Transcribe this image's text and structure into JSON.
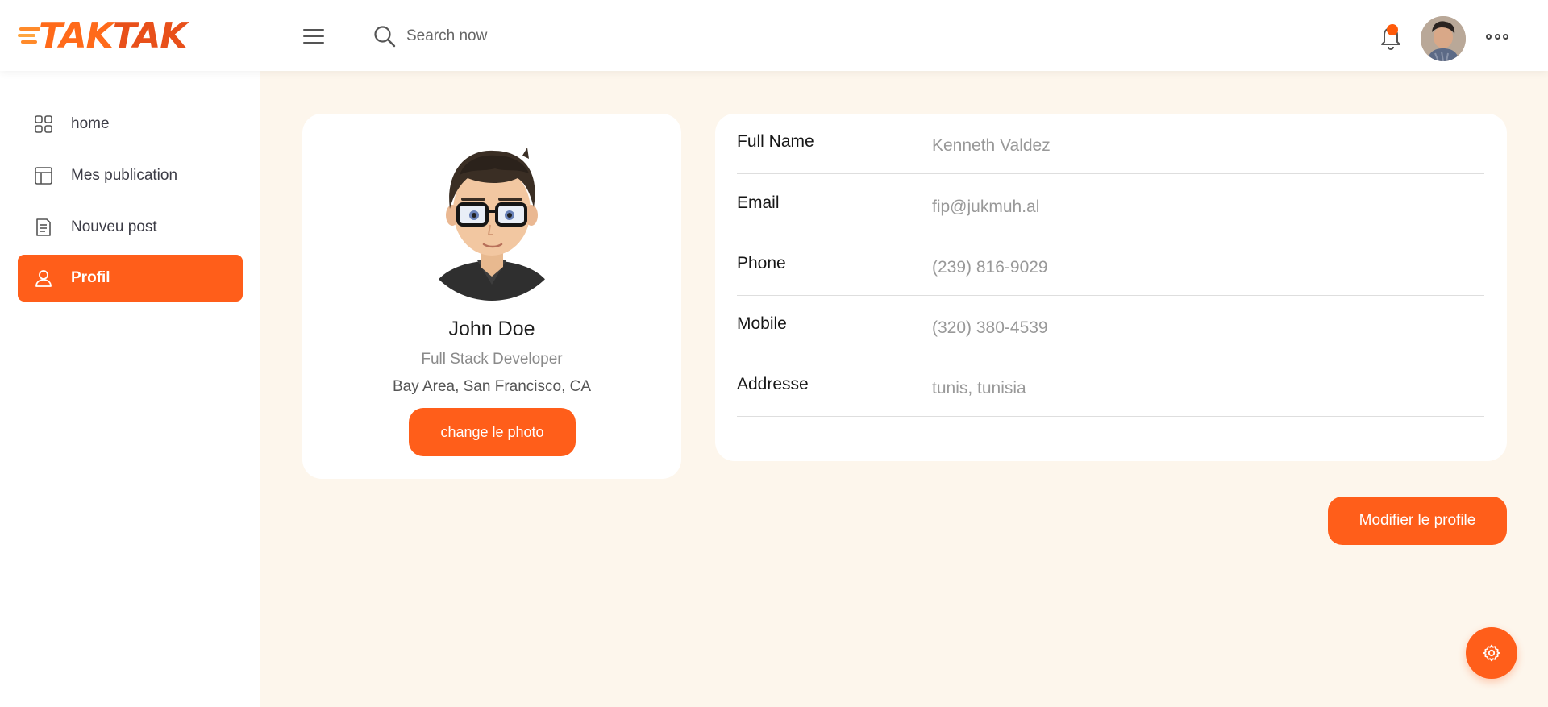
{
  "brand": {
    "logo_text_a": "TAK",
    "logo_text_b": "TAK",
    "accent": "#ff5e1a"
  },
  "header": {
    "search_placeholder": "Search now",
    "icons": [
      "menu-icon",
      "search-icon",
      "bell-icon",
      "user-avatar",
      "more-icon"
    ]
  },
  "sidebar": {
    "items": [
      {
        "label": "home",
        "icon": "grid-icon",
        "active": false
      },
      {
        "label": "Mes publication",
        "icon": "layout-icon",
        "active": false
      },
      {
        "label": "Nouveu post",
        "icon": "document-icon",
        "active": false
      },
      {
        "label": "Profil",
        "icon": "user-icon",
        "active": true
      }
    ]
  },
  "profile": {
    "name": "John Doe",
    "role": "Full Stack Developer",
    "location": "Bay Area, San Francisco, CA",
    "change_photo_label": "change le photo"
  },
  "details": [
    {
      "label": "Full Name",
      "value": "Kenneth Valdez"
    },
    {
      "label": "Email",
      "value": "fip@jukmuh.al"
    },
    {
      "label": "Phone",
      "value": "(239) 816-9029"
    },
    {
      "label": "Mobile",
      "value": "(320) 380-4539"
    },
    {
      "label": "Addresse",
      "value": "tunis, tunisia"
    }
  ],
  "actions": {
    "edit_profile_label": "Modifier le profile",
    "settings_icon": "gear-icon"
  }
}
